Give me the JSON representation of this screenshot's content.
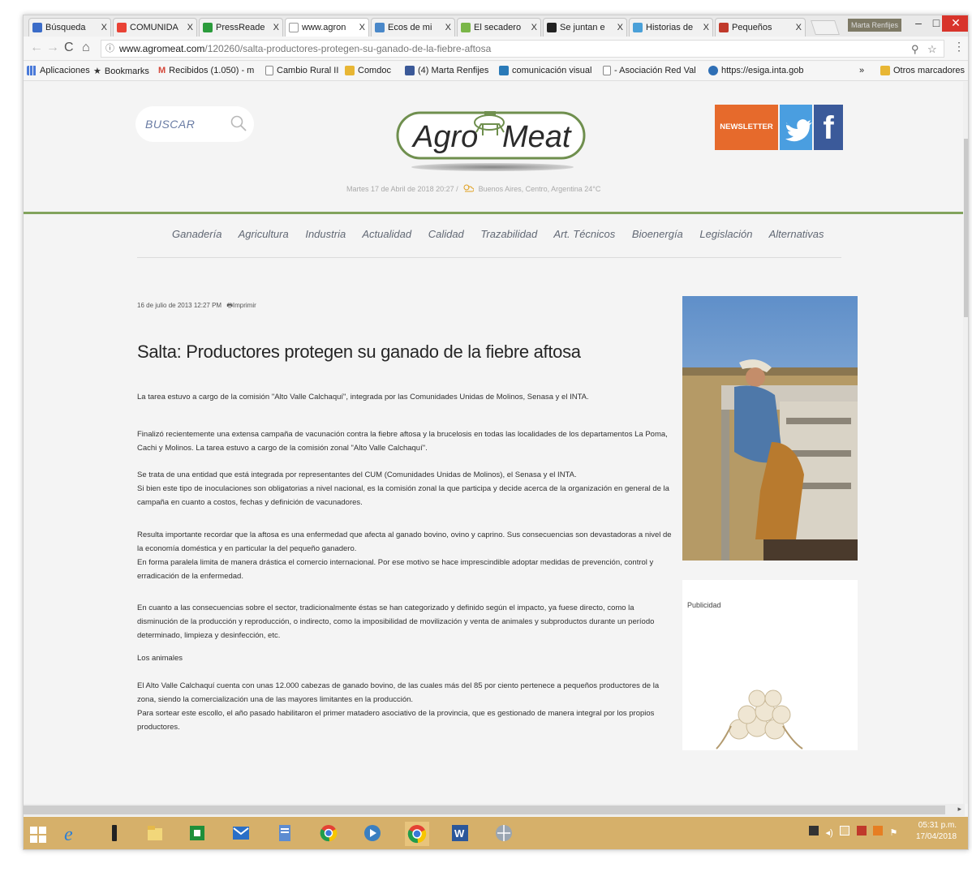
{
  "tabs": [
    {
      "label": "Búsqueda",
      "favicon_color": "#3b6cc8"
    },
    {
      "label": "COMUNIDA",
      "favicon_color": "#e94235"
    },
    {
      "label": "PressReade",
      "favicon_color": "#2b9b3c"
    },
    {
      "label": "www.agron",
      "favicon_color": "#ffffff",
      "active": true
    },
    {
      "label": "Ecos de mi",
      "favicon_color": "#4a88c9"
    },
    {
      "label": "El secadero",
      "favicon_color": "#7ab648"
    },
    {
      "label": "Se juntan e",
      "favicon_color": "#222222"
    },
    {
      "label": "Historias de",
      "favicon_color": "#4aa0d8"
    },
    {
      "label": "Pequeños",
      "favicon_color": "#c0392b"
    }
  ],
  "tab_close_glyph": "X",
  "window": {
    "profile": "Marta Renfijes",
    "minimize": "–",
    "maximize": "□",
    "close": "✕"
  },
  "url": {
    "domain": "www.agromeat.com",
    "path": "/120260/salta-productores-protegen-su-ganado-de-la-fiebre-aftosa"
  },
  "bookmarks": [
    {
      "label": "Aplicaciones",
      "icon_color": "#4a7ad9"
    },
    {
      "label": "Bookmarks",
      "icon_color": "#333333"
    },
    {
      "label": "Recibidos (1.050) - m",
      "icon_color": "#d44638"
    },
    {
      "label": "Cambio Rural II",
      "icon_color": "#999999"
    },
    {
      "label": "Comdoc",
      "icon_color": "#e8b634"
    },
    {
      "label": "(4) Marta Renfijes",
      "icon_color": "#3b5998"
    },
    {
      "label": "comunicación visual",
      "icon_color": "#2a7ab8"
    },
    {
      "label": "- Asociación Red Val",
      "icon_color": "#999999"
    },
    {
      "label": "https://esiga.inta.gob",
      "icon_color": "#2f6fb5"
    }
  ],
  "bookmarks_more": "»",
  "other_bookmarks": "Otros marcadores",
  "site": {
    "search_placeholder": "BUSCAR",
    "logo_left": "Agro",
    "logo_right": "Meat",
    "newsletter": "NEWSLETTER",
    "facebook_glyph": "f",
    "dateline": "Martes 17 de Abril de 2018 20:27 /",
    "weather": "Buenos Aires, Centro, Argentina 24°C",
    "nav": [
      "Ganadería",
      "Agricultura",
      "Industria",
      "Actualidad",
      "Calidad",
      "Trazabilidad",
      "Art. Técnicos",
      "Bioenergía",
      "Legislación",
      "Alternativas"
    ],
    "colors": {
      "green": "#82a35d",
      "newsletter": "#e66a2c",
      "twitter": "#4a9ee0",
      "facebook": "#3b5a9a"
    }
  },
  "article": {
    "date": "16 de julio de 2013 12:27 PM",
    "print": "Imprimir",
    "title": "Salta: Productores protegen su ganado de la fiebre aftosa",
    "paragraphs": [
      "La tarea estuvo a cargo de la comisión \"Alto Valle Calchaquí\", integrada por las Comunidades Unidas de Molinos, Senasa y el INTA.",
      "Finalizó recientemente una extensa campaña de vacunación contra la fiebre aftosa y la brucelosis en todas las localidades de los departamentos La Poma, Cachi y Molinos. La tarea estuvo a cargo de la comisión zonal \"Alto Valle Calchaquí\".",
      "Se trata de una entidad que está integrada por representantes del CUM (Comunidades Unidas de Molinos), el Senasa y el INTA.",
      "Si bien este tipo de inoculaciones son obligatorias a nivel nacional, es la comisión zonal la que participa y decide acerca de la organización en general de la campaña en cuanto a costos, fechas y definición de vacunadores.",
      "Resulta importante recordar que la aftosa es una enfermedad que afecta al ganado bovino, ovino y caprino. Sus consecuencias son devastadoras a nivel de la economía doméstica y en particular la del pequeño ganadero.",
      "En forma paralela limita de manera drástica el comercio internacional. Por ese motivo se hace imprescindible adoptar medidas de prevención, control y erradicación de la enfermedad.",
      "En cuanto a las consecuencias sobre el sector, tradicionalmente éstas se han categorizado y definido según el impacto, ya fuese directo, como la disminución de la producción y reproducción, o indirecto, como la imposibilidad de movilización y venta de animales y subproductos durante un período determinado, limpieza y desinfección, etc.",
      "Los animales",
      "El Alto Valle Calchaquí cuenta con unas 12.000 cabezas de ganado bovino, de las cuales más del 85 por ciento pertenece a pequeños productores de la zona, siendo la comercialización una de las mayores limitantes en la producción.",
      "Para sortear este escollo, el año pasado habilitaron el primer matadero asociativo de la provincia, que es gestionado de manera integral por los propios productores."
    ]
  },
  "sidebar": {
    "ad_label": "Publicidad"
  },
  "taskbar": {
    "time": "05:31 p.m.",
    "date": "17/04/2018"
  }
}
